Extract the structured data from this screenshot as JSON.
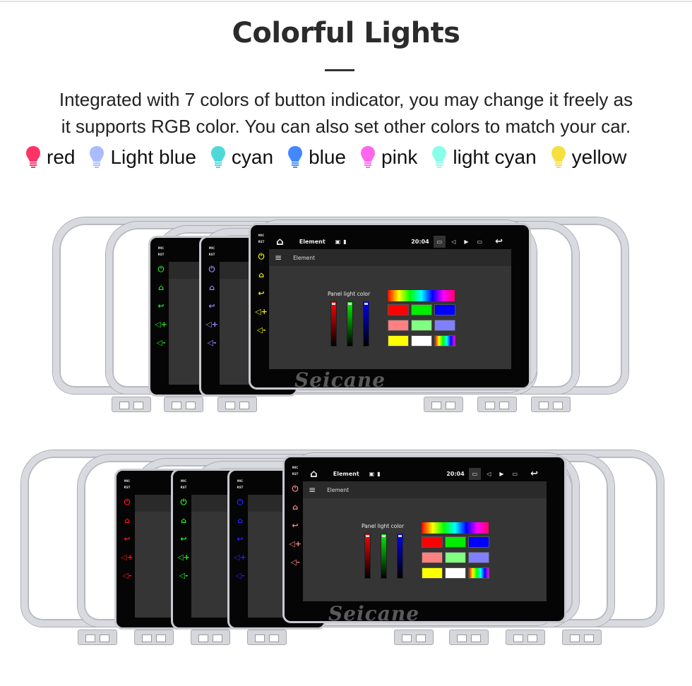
{
  "title": "Colorful Lights",
  "description_lines": [
    "Integrated with 7 colors of button indicator, you may change it freely as",
    "it supports RGB color. You can also set other colors to match your car."
  ],
  "legend": [
    {
      "label": "red",
      "color": "#ff3366"
    },
    {
      "label": "Light blue",
      "color": "#aabbff"
    },
    {
      "label": "cyan",
      "color": "#4fd8d8"
    },
    {
      "label": "blue",
      "color": "#4488ff"
    },
    {
      "label": "pink",
      "color": "#ff66ee"
    },
    {
      "label": "light cyan",
      "color": "#88ffe8"
    },
    {
      "label": "yellow",
      "color": "#f5e040"
    }
  ],
  "screen": {
    "app_title": "Element",
    "time": "20:04",
    "toolbar_title": "Element",
    "panel_label": "Panel light color",
    "side_labels": [
      "MIC",
      "RST"
    ],
    "watermark": "Seicane",
    "palette": [
      "#ff0000",
      "#00ee00",
      "#0000ff",
      "#ff8080",
      "#80ff80",
      "#8080ff",
      "#ffff00",
      "#ffffff",
      "rainbow"
    ],
    "sliders": [
      "#ff0000",
      "#00ee00",
      "#0000ee"
    ]
  },
  "rows": [
    {
      "button_colors": [
        "#22dd22",
        "#9988ff",
        "#e8e800"
      ]
    },
    {
      "button_colors": [
        "#ff1111",
        "#22ee22",
        "#2222ff",
        "#ff8888"
      ]
    }
  ]
}
